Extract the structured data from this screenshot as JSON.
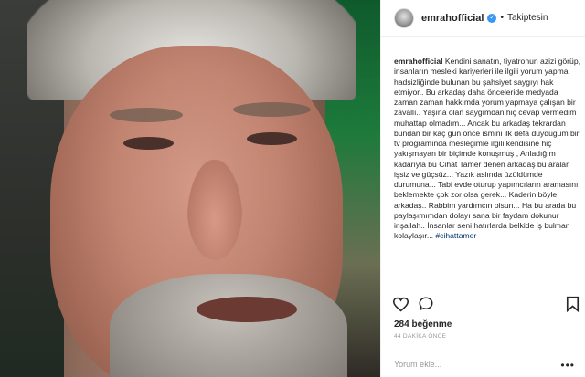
{
  "post": {
    "photo_alt": "",
    "header": {
      "username": "emrahofficial",
      "separator": "•",
      "follow_status": "Takiptesin",
      "verified_icon": "verified-badge-icon"
    },
    "caption": {
      "username": "emrahofficial",
      "text": "Kendini sanatın, tiyatronun azizi görüp, insanların mesleki kariyerleri ile ilgili yorum yapma hadsizliğinde bulunan bu şahsiyet saygıyı hak etmiyor.. Bu arkadaş daha önceleride medyada zaman zaman hakkımda yorum yapmaya çalışan bir zavallı.. Yaşına olan saygımdan hiç cevap vermedim muhattap olmadım... Ancak bu arkadaş tekrardan bundan bir kaç gün once ismini ilk defa duyduğum bir tv programında mesleğimle ilgili kendisine hiç yakışmayan bir biçimde konuşmuş , Anladığım kadarıyla bu Cihat Tamer denen arkadaş bu aralar işsiz ve güçsüz... Yazık aslında üzüldümde durumuna... Tabi evde oturup yapımcıların aramasını beklemekte çok zor olsa gerek... Kaderin böyle arkadaş.. Rabbim yardımcın olsun... Ha bu arada bu paylaşımımdan dolayı sana bir faydam dokunur inşallah.. İnsanlar seni hatırlarda belkide iş bulman kolaylaşır... ",
      "hashtag": "#cihattamer"
    },
    "actions": {
      "like_icon": "heart-icon",
      "comment_icon": "comment-icon",
      "save_icon": "bookmark-icon"
    },
    "likes": "284 beğenme",
    "time_ago": "44 DAKİKA ÖNCE",
    "comment": {
      "placeholder": "Yorum ekle...",
      "more": "•••"
    }
  },
  "colors": {
    "verified": "#3897f0",
    "hashtag": "#003569",
    "muted": "#999999",
    "border": "#efefef"
  }
}
